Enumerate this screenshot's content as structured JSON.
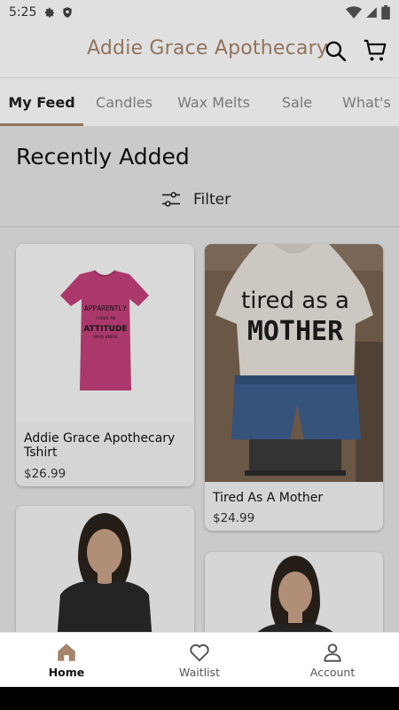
{
  "status_bar": {
    "time": "5:25",
    "icons": [
      "gear-icon",
      "shield-icon",
      "wifi-icon",
      "signal-icon",
      "battery-icon"
    ]
  },
  "header": {
    "brand": "Addie Grace Apothecary",
    "brand_color": "#a6846a",
    "search_icon": "search-icon",
    "cart_icon": "cart-icon"
  },
  "tabs": [
    {
      "label": "My Feed",
      "active": true
    },
    {
      "label": "Candles",
      "active": false
    },
    {
      "label": "Wax Melts",
      "active": false
    },
    {
      "label": "Sale",
      "active": false
    },
    {
      "label": "What's",
      "active": false
    }
  ],
  "main": {
    "section_title": "Recently Added",
    "filter_label": "Filter"
  },
  "products": [
    {
      "name": "Addie Grace Apothecary Tshirt",
      "price": "$26.99",
      "shirt_text": [
        "APPARENTLY",
        "I HAVE AN",
        "ATTITUDE",
        "WHO KNEW"
      ]
    },
    {
      "name": "Tired As A Mother",
      "price": "$24.99",
      "shirt_text": [
        "tired as a",
        "MOTHER"
      ]
    },
    {
      "name": "",
      "price": ""
    },
    {
      "name": "",
      "price": ""
    }
  ],
  "bottom_nav": [
    {
      "label": "Home",
      "icon": "home-icon",
      "active": true
    },
    {
      "label": "Waitlist",
      "icon": "heart-icon",
      "active": false
    },
    {
      "label": "Account",
      "icon": "person-icon",
      "active": false
    }
  ]
}
